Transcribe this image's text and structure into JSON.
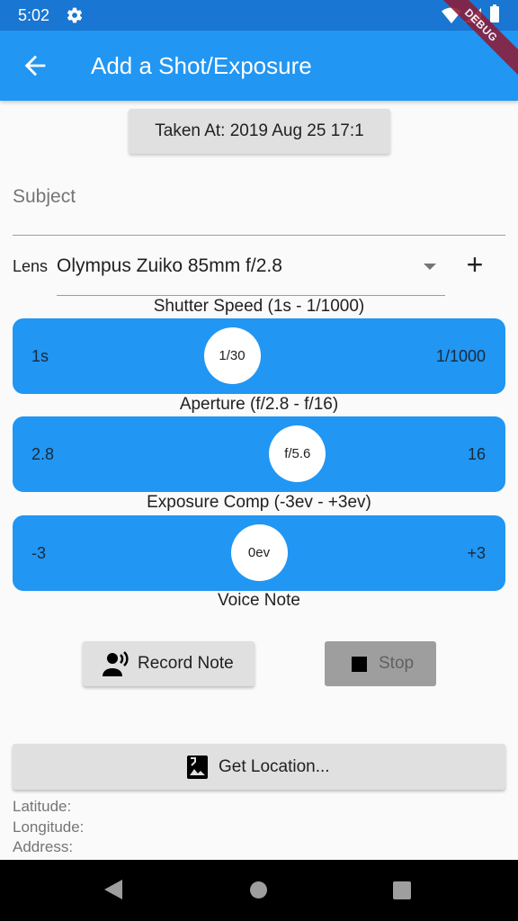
{
  "status_bar": {
    "time": "5:02"
  },
  "debug_banner": "DEBUG",
  "app_bar": {
    "title": "Add a Shot/Exposure"
  },
  "taken_at_button": "Taken At: 2019 Aug 25 17:1",
  "subject_field": {
    "placeholder": "Subject",
    "value": ""
  },
  "lens": {
    "label": "Lens",
    "selected": "Olympus Zuiko 85mm f/2.8",
    "add_label": "+"
  },
  "sliders": {
    "shutter": {
      "label": "Shutter Speed (1s - 1/1000)",
      "min": "1s",
      "max": "1/1000",
      "value": "1/30",
      "fraction": 0.43
    },
    "aperture": {
      "label": "Aperture (f/2.8 - f/16)",
      "min": "2.8",
      "max": "16",
      "value": "f/5.6",
      "fraction": 0.6
    },
    "exposure": {
      "label": "Exposure Comp (-3ev - +3ev)",
      "min": "-3",
      "max": "+3",
      "value": "0ev",
      "fraction": 0.5
    }
  },
  "voice_note": {
    "heading": "Voice Note",
    "record_label": "Record Note",
    "stop_label": "Stop"
  },
  "location": {
    "button_label": "Get Location...",
    "latitude_label": "Latitude:",
    "longitude_label": "Longitude:",
    "address_label": "Address:"
  },
  "colors": {
    "primary": "#2196f3",
    "status_bar": "#1976d2",
    "button": "#e0e0e0",
    "disabled_button": "#9e9e9e"
  }
}
